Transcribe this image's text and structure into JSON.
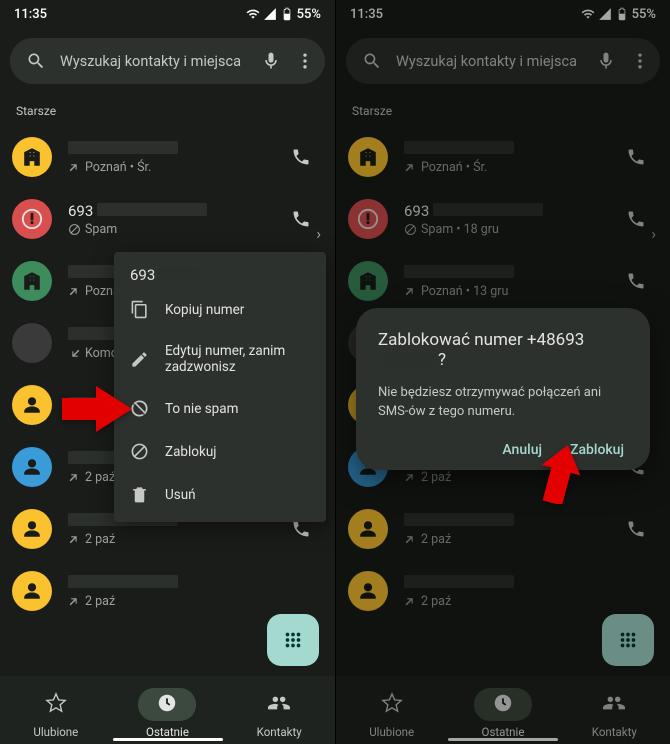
{
  "statusbar": {
    "time": "11:35",
    "battery": "55%"
  },
  "search": {
    "placeholder": "Wyszukaj kontakty i miejsca"
  },
  "section_header": "Starsze",
  "rows_left": [
    {
      "avatar_color": "#f9c22e",
      "icon": "building",
      "name_redacted": true,
      "sub_icon": "outgoing",
      "sub": "Poznań • Śr.",
      "call": true
    },
    {
      "avatar_color": "#d94e4e",
      "icon": "alert",
      "name": "693",
      "name_redacted_after": true,
      "sub_icon": "block",
      "sub": "Spam",
      "call": true,
      "missed": true
    },
    {
      "avatar_color": "#3c8c5c",
      "icon": "building",
      "name_redacted": true,
      "sub_icon": "outgoing",
      "sub": "Poznan",
      "call": false
    },
    {
      "avatar_color": "#3a3a3a",
      "icon": "square",
      "name_redacted": true,
      "sub_icon": "incoming",
      "sub": "Komór",
      "call": false
    },
    {
      "avatar_color": "#f9c22e",
      "icon": "person",
      "name_redacted": true,
      "sub": "",
      "call": false
    },
    {
      "avatar_color": "#3a9bd9",
      "icon": "person",
      "name_redacted": true,
      "sub_icon": "outgoing",
      "sub": "2 paź",
      "call": true
    },
    {
      "avatar_color": "#f9c22e",
      "icon": "person",
      "name_redacted": true,
      "sub_icon": "outgoing",
      "sub": "2 paź",
      "call": true
    },
    {
      "avatar_color": "#f9c22e",
      "icon": "person",
      "name_redacted": true,
      "sub_icon": "outgoing",
      "sub": "2 paź",
      "call": false
    }
  ],
  "rows_right": [
    {
      "avatar_color": "#f9c22e",
      "icon": "building",
      "name_redacted": true,
      "sub_icon": "outgoing",
      "sub": "Poznań • Śr.",
      "call": true
    },
    {
      "avatar_color": "#d94e4e",
      "icon": "alert",
      "name": "693",
      "name_redacted_after": true,
      "sub_icon": "block",
      "sub": "Spam • 18 gru",
      "call": true,
      "missed": true
    },
    {
      "avatar_color": "#3c8c5c",
      "icon": "building",
      "name_redacted": true,
      "sub_icon": "outgoing",
      "sub": "Poznań • 13 gru",
      "call": true
    },
    {
      "avatar_color": "#3a3a3a",
      "icon": "square",
      "name_redacted": true,
      "sub": "",
      "call": false
    },
    {
      "avatar_color": "#f9c22e",
      "icon": "person",
      "name_redacted": true,
      "sub": "",
      "call": false
    },
    {
      "avatar_color": "#3a9bd9",
      "icon": "person",
      "name_redacted": true,
      "sub_icon": "outgoing",
      "sub": "2 paź",
      "call": true
    },
    {
      "avatar_color": "#f9c22e",
      "icon": "person",
      "name_redacted": true,
      "sub_icon": "outgoing",
      "sub": "2 paź",
      "call": true
    },
    {
      "avatar_color": "#f9c22e",
      "icon": "person",
      "name_redacted": true,
      "sub_icon": "outgoing",
      "sub": "2 paź",
      "call": false
    }
  ],
  "context_menu": {
    "title": "693",
    "items": [
      {
        "icon": "copy",
        "label": "Kopiuj numer"
      },
      {
        "icon": "edit",
        "label": "Edytuj numer, zanim zadzwonisz"
      },
      {
        "icon": "notspam",
        "label": "To nie spam"
      },
      {
        "icon": "block",
        "label": "Zablokuj"
      },
      {
        "icon": "trash",
        "label": "Usuń"
      }
    ]
  },
  "dialog": {
    "title_prefix": "Zablokować numer +48693",
    "title_suffix": "?",
    "message": "Nie będziesz otrzymywać połączeń ani SMS-ów z tego numeru.",
    "cancel": "Anuluj",
    "confirm": "Zablokuj"
  },
  "nav": {
    "favorites": "Ulubione",
    "recents": "Ostatnie",
    "contacts": "Kontakty"
  }
}
